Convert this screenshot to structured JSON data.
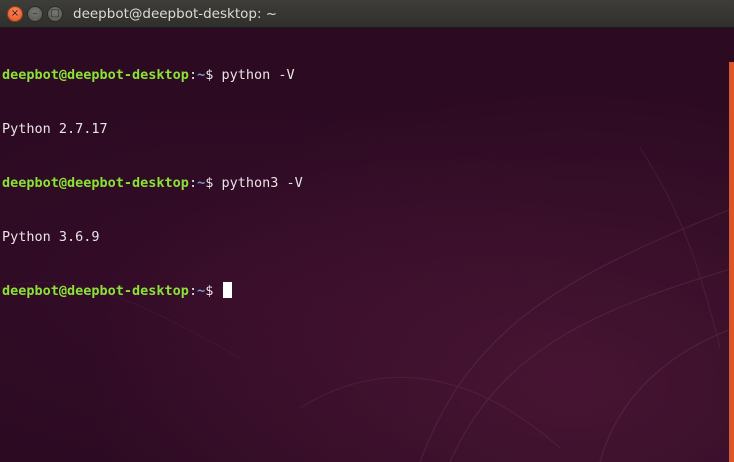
{
  "window": {
    "title": "deepbot@deepbot-desktop: ~",
    "close_glyph": "×",
    "min_glyph": "–",
    "max_glyph": "□"
  },
  "terminal": {
    "lines": [
      {
        "type": "command",
        "user_host": "deepbot@deepbot-desktop",
        "sep": ":",
        "path": "~",
        "symbol": "$ ",
        "command": "python -V"
      },
      {
        "type": "output",
        "text": "Python 2.7.17"
      },
      {
        "type": "command",
        "user_host": "deepbot@deepbot-desktop",
        "sep": ":",
        "path": "~",
        "symbol": "$ ",
        "command": "python3 -V"
      },
      {
        "type": "output",
        "text": "Python 3.6.9"
      },
      {
        "type": "prompt",
        "user_host": "deepbot@deepbot-desktop",
        "sep": ":",
        "path": "~",
        "symbol": "$ ",
        "command": ""
      }
    ]
  },
  "colors": {
    "background": "#2c0a22",
    "prompt": "#8ae234",
    "path": "#729fcf",
    "text": "#e9e4e6",
    "scrollbar": "#d9572a"
  }
}
